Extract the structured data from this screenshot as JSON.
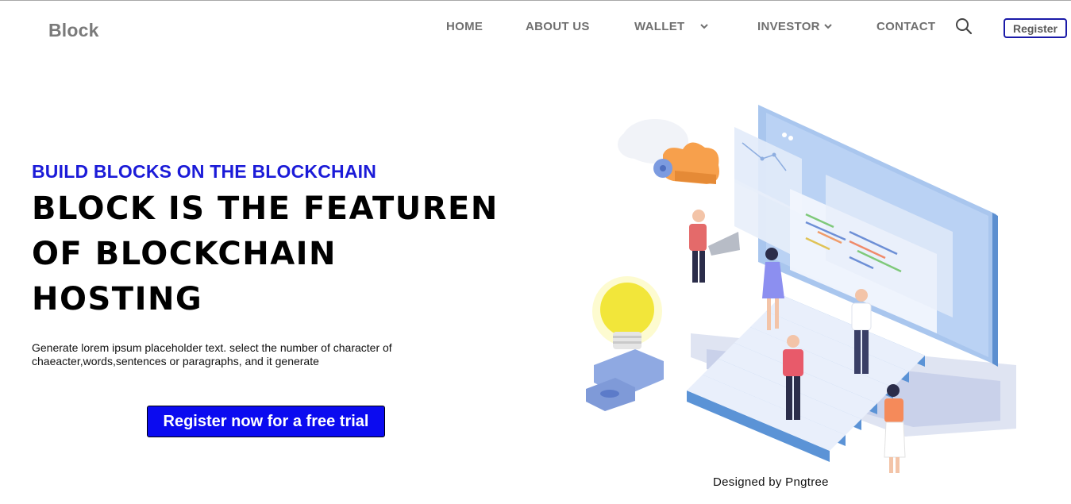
{
  "brand": {
    "logo": "Block"
  },
  "nav": {
    "items": [
      {
        "label": "HOME",
        "has_dropdown": false
      },
      {
        "label": "ABOUT US",
        "has_dropdown": false
      },
      {
        "label": "WALLET",
        "has_dropdown": true
      },
      {
        "label": "INVESTOR",
        "has_dropdown": true
      },
      {
        "label": "CONTACT",
        "has_dropdown": false
      }
    ],
    "search_icon": "search-icon",
    "register_label": "Register"
  },
  "hero": {
    "subtitle": "BUILD BLOCKS ON THE BLOCKCHAIN",
    "headline_lines": [
      "BLOCK IS THE FEATUREN",
      "OF BLOCKCHAIN",
      "HOSTING"
    ],
    "description_lines": [
      "Generate lorem ipsum placeholder text. select the number of character of",
      "chaeacter,words,sentences or paragraphs, and it generate"
    ],
    "cta_label": "Register now for a free trial"
  },
  "illustration": {
    "credit": "Designed by Pngtree"
  },
  "colors": {
    "accent": "#0b0bf0",
    "subtitle": "#1b1bd8",
    "nav_text": "#6f6f6f",
    "register_border": "#1a1aa8"
  }
}
